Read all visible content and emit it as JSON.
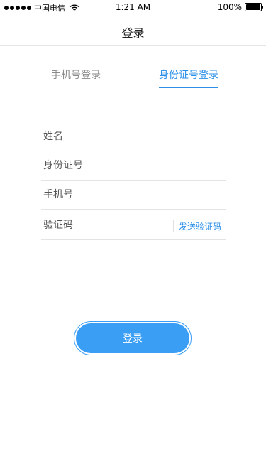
{
  "status_bar": {
    "carrier": "中国电信",
    "time": "1:21 AM",
    "battery": "100%",
    "battery_level": 1.0,
    "signal_icon": "signal-dots-icon",
    "wifi_icon": "wifi-icon"
  },
  "nav": {
    "title": "登录"
  },
  "tabs": [
    {
      "label": "手机号登录",
      "active": false
    },
    {
      "label": "身份证号登录",
      "active": true
    }
  ],
  "form": {
    "name_placeholder": "姓名",
    "id_placeholder": "身份证号",
    "phone_placeholder": "手机号",
    "code_placeholder": "验证码",
    "send_code_label": "发送验证码"
  },
  "login_button": {
    "label": "登录"
  },
  "colors": {
    "accent": "#2b8fe8",
    "button": "#3a9ef5",
    "inactive_tab": "#8a8a8a",
    "divider": "#e4e4e4"
  }
}
